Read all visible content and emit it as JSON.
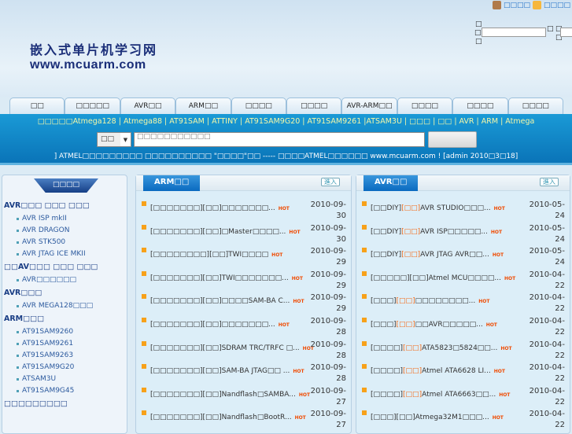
{
  "logo": {
    "title": "嵌入式单片机学习网",
    "url": "www.mcuarm.com"
  },
  "toplinks": [
    {
      "icon": "home-icon",
      "label": "□□□□"
    },
    {
      "icon": "folder-icon",
      "label": "□□□□"
    }
  ],
  "login": {
    "l1": "□",
    "l2": "□□",
    "l3": "□",
    "l4": "□",
    "l5": "□",
    "l6": "□"
  },
  "tabs": [
    "□□",
    "□□□□□",
    "AVR□□",
    "ARM□□",
    "□□□□",
    "□□□□",
    "AVR-ARM□□",
    "□□□□",
    "□□□□",
    "□□□□"
  ],
  "keywords": "□□□□□Atmega128 | Atmega88 | AT91SAM | ATTINY | AT91SAM9G20 | AT91SAM9261 |ATSAM3U | □□□ | □□ | AVR | ARM | Atmega",
  "search": {
    "scope": "□□",
    "placeholder": "□□□□□□□□□□□",
    "button": ""
  },
  "notice": "] ATMEL□□□□□□□□□ □□□□□□□□□□ \"□□□□\"□□ ----- □□□□ATMEL□□□□□□ www.mcuarm.com !  [admin  2010□3□18]",
  "sidebar": {
    "title": "□□□□",
    "groups": [
      {
        "label": "AVR□□□ □□□ □□□",
        "items": [
          "AVR ISP mkII",
          "AVR DRAGON",
          "AVR STK500",
          "AVR JTAG ICE MKII"
        ]
      },
      {
        "label": "□□AV□□□ □□□ □□□",
        "items": [
          "AVR□□□□□□"
        ]
      },
      {
        "label": "AVR□□□",
        "items": [
          "AVR MEGA128□□□"
        ]
      },
      {
        "label": "ARM□□□",
        "items": [
          "AT91SAM9260",
          "AT91SAM9261",
          "AT91SAM9263",
          "AT91SAM9G20",
          "ATSAM3U",
          "AT91SAM9G45"
        ]
      },
      {
        "label": "□□□□□□□□□",
        "items": []
      }
    ]
  },
  "arm": {
    "title": "ARM□□",
    "enter": "進入",
    "hot": "HOT",
    "rows": [
      {
        "cat": "[□□□□□□□]",
        "tag": "[□□]",
        "title": "□□□□□□□...",
        "date": "2010-09-30"
      },
      {
        "cat": "[□□□□□□□]",
        "tag": "[□□]",
        "title": "□Master□□□□...",
        "date": "2010-09-30"
      },
      {
        "cat": "[□□□□□□□□]",
        "tag": "[□□]",
        "title": "TWI□□□□",
        "date": "2010-09-29"
      },
      {
        "cat": "[□□□□□□□]",
        "tag": "[□□]",
        "title": "TWI□□□□□□□...",
        "date": "2010-09-29"
      },
      {
        "cat": "[□□□□□□□]",
        "tag": "[□□]",
        "title": "□□□□SAM-BA C...",
        "date": "2010-09-29"
      },
      {
        "cat": "[□□□□□□□]",
        "tag": "[□□]",
        "title": "□□□□□□□...",
        "date": "2010-09-28"
      },
      {
        "cat": "[□□□□□□□]",
        "tag": "[□□]",
        "title": "SDRAM TRC/TRFC □...",
        "date": "2010-09-28"
      },
      {
        "cat": "[□□□□□□□]",
        "tag": "[□□]",
        "title": "SAM-BA JTAG□□ ...",
        "date": "2010-09-28"
      },
      {
        "cat": "[□□□□□□□]",
        "tag": "[□□]",
        "title": "Nandflash□SAMBA...",
        "date": "2010-09-27"
      },
      {
        "cat": "[□□□□□□□]",
        "tag": "[□□]",
        "title": "Nandflash□BootR...",
        "date": "2010-09-27"
      }
    ]
  },
  "avr": {
    "title": "AVR□□",
    "enter": "進入",
    "hot": "HOT",
    "rows": [
      {
        "cat": "[□□DIY]",
        "tag": "[□□]",
        "hl": true,
        "title": "AVR STUDIO□□□...",
        "date": "2010-05-24"
      },
      {
        "cat": "[□□DIY]",
        "tag": "[□□]",
        "hl": true,
        "title": "AVR ISP□□□□□...",
        "date": "2010-05-24"
      },
      {
        "cat": "[□□DIY]",
        "tag": "[□□]",
        "hl": true,
        "title": "AVR JTAG AVR□□...",
        "date": "2010-05-24"
      },
      {
        "cat": "[□□□□□]",
        "tag": "[□□]",
        "hl": false,
        "title": "Atmel MCU□□□□...",
        "date": "2010-04-22"
      },
      {
        "cat": "[□□□]",
        "tag": "[□□]",
        "hl": true,
        "title": "□□□□□□□□...",
        "date": "2010-04-22"
      },
      {
        "cat": "[□□□]",
        "tag": "[□□]",
        "hl": true,
        "title": "□□AVR□□□□□...",
        "date": "2010-04-22"
      },
      {
        "cat": "[□□□□]",
        "tag": "[□□]",
        "hl": true,
        "title": "ATA5823□5824□□...",
        "date": "2010-04-22"
      },
      {
        "cat": "[□□□□]",
        "tag": "[□□]",
        "hl": true,
        "title": "Atmel ATA6628 LI...",
        "date": "2010-04-22"
      },
      {
        "cat": "[□□□□]",
        "tag": "[□□]",
        "hl": true,
        "title": "Atmel ATA6663□□...",
        "date": "2010-04-22"
      },
      {
        "cat": "[□□□]",
        "tag": "[□□]",
        "hl": false,
        "title": "Atmega32M1□□□...",
        "date": "2010-04-22"
      }
    ]
  }
}
